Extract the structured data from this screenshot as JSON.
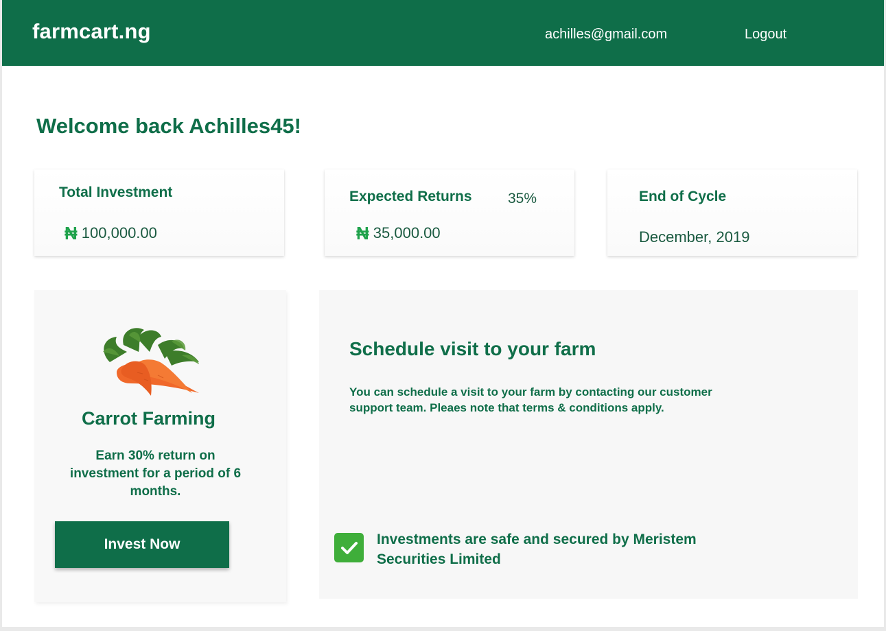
{
  "header": {
    "brand": "farmcart.ng",
    "email": "achilles@gmail.com",
    "logout_label": "Logout"
  },
  "welcome": "Welcome back Achilles45!",
  "stats": {
    "total_investment": {
      "title": "Total Investment",
      "currency_symbol": "₦",
      "value": "100,000.00"
    },
    "expected_returns": {
      "title": "Expected Returns",
      "percent": "35%",
      "currency_symbol": "₦",
      "value": "35,000.00"
    },
    "end_of_cycle": {
      "title": "End of Cycle",
      "value": "December, 2019"
    }
  },
  "product": {
    "image_icon": "carrot-icon",
    "title": "Carrot Farming",
    "description": "Earn 30% return on investment for a period of 6 months.",
    "cta_label": "Invest Now"
  },
  "visit": {
    "title": "Schedule visit to your farm",
    "text": "You can schedule a visit to your farm by contacting our customer support team. Pleaes note that terms & conditions apply.",
    "secure_icon": "check-icon",
    "secure_text": "Investments are safe and secured by Meristem Securities Limited"
  },
  "colors": {
    "primary": "#0f6e49",
    "accent_green": "#1fa24b",
    "check_green": "#3fae3a",
    "carrot_orange": "#f0682a"
  }
}
